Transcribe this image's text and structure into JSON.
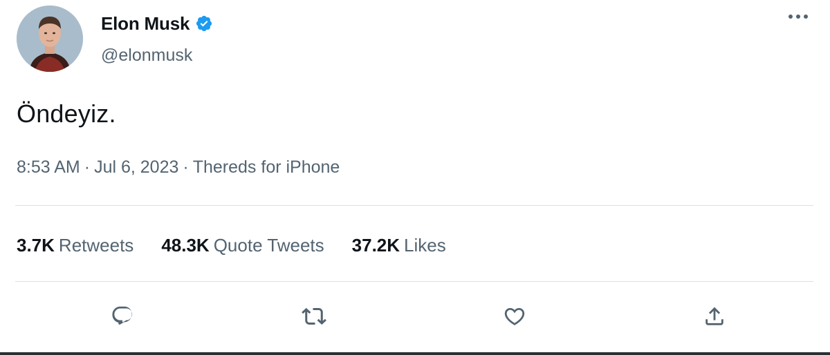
{
  "user": {
    "display_name": "Elon Musk",
    "handle": "@elonmusk",
    "verified": true,
    "avatar_icon": "profile-photo"
  },
  "tweet": {
    "text": "Öndeyiz.",
    "time": "8:53 AM",
    "date": "Jul 6, 2023",
    "source": "Thereds for iPhone",
    "separator": "·"
  },
  "stats": [
    {
      "count": "3.7K",
      "label": "Retweets"
    },
    {
      "count": "48.3K",
      "label": "Quote Tweets"
    },
    {
      "count": "37.2K",
      "label": "Likes"
    }
  ],
  "actions": [
    {
      "name": "reply",
      "icon": "reply-icon"
    },
    {
      "name": "retweet",
      "icon": "retweet-icon"
    },
    {
      "name": "like",
      "icon": "heart-icon"
    },
    {
      "name": "share",
      "icon": "share-icon"
    }
  ],
  "colors": {
    "text_primary": "#0f1419",
    "text_secondary": "#536471",
    "verified_blue": "#1d9bf0",
    "divider": "#dcdfe2"
  }
}
